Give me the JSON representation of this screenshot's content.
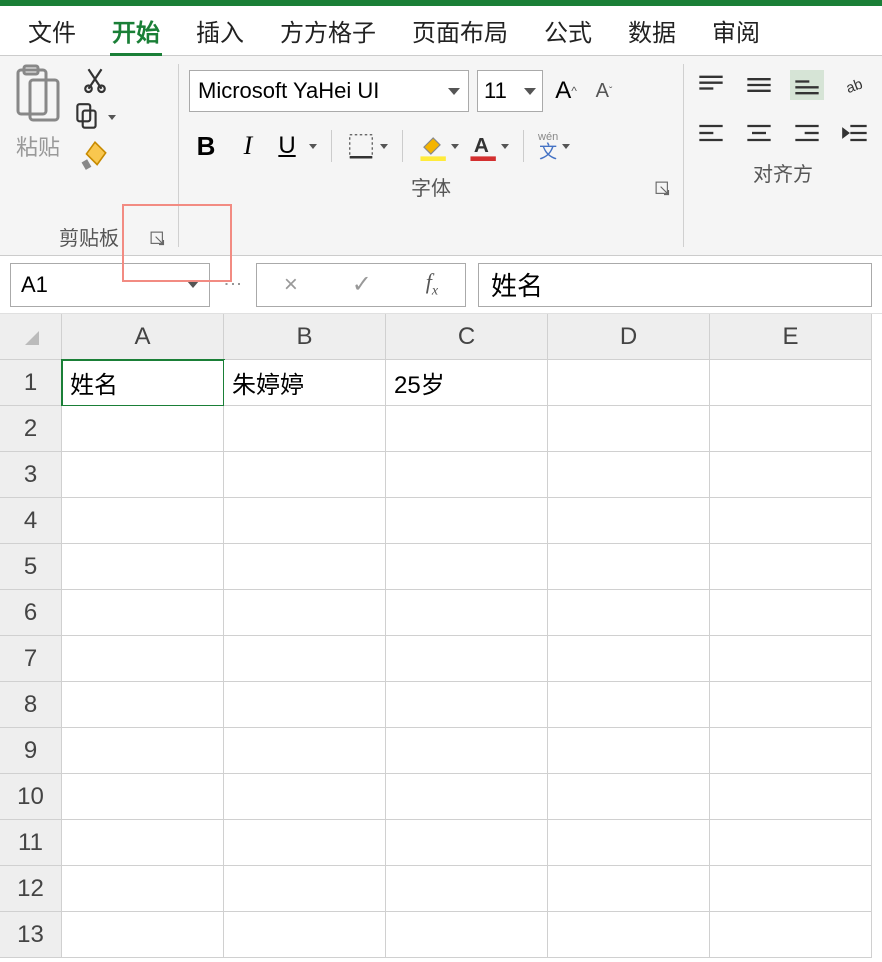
{
  "tabs": {
    "file": "文件",
    "home": "开始",
    "insert": "插入",
    "ffgz": "方方格子",
    "page_layout": "页面布局",
    "formulas": "公式",
    "data": "数据",
    "review": "审阅"
  },
  "ribbon": {
    "clipboard": {
      "paste_label": "粘贴",
      "group_label": "剪贴板"
    },
    "font": {
      "font_name": "Microsoft YaHei UI",
      "font_size": "11",
      "group_label": "字体",
      "bold": "B",
      "italic": "I",
      "underline": "U",
      "wen": "wén",
      "wen_char": "文"
    },
    "alignment": {
      "group_label": "对齐方"
    }
  },
  "formula_bar": {
    "name_box": "A1",
    "fx": "fx",
    "value": "姓名"
  },
  "sheet": {
    "columns": [
      "A",
      "B",
      "C",
      "D",
      "E"
    ],
    "rows": [
      "1",
      "2",
      "3",
      "4",
      "5",
      "6",
      "7",
      "8",
      "9",
      "10",
      "11",
      "12",
      "13"
    ],
    "cells": {
      "A1": "姓名",
      "B1": "朱婷婷",
      "C1": "25岁"
    },
    "selected": "A1"
  }
}
